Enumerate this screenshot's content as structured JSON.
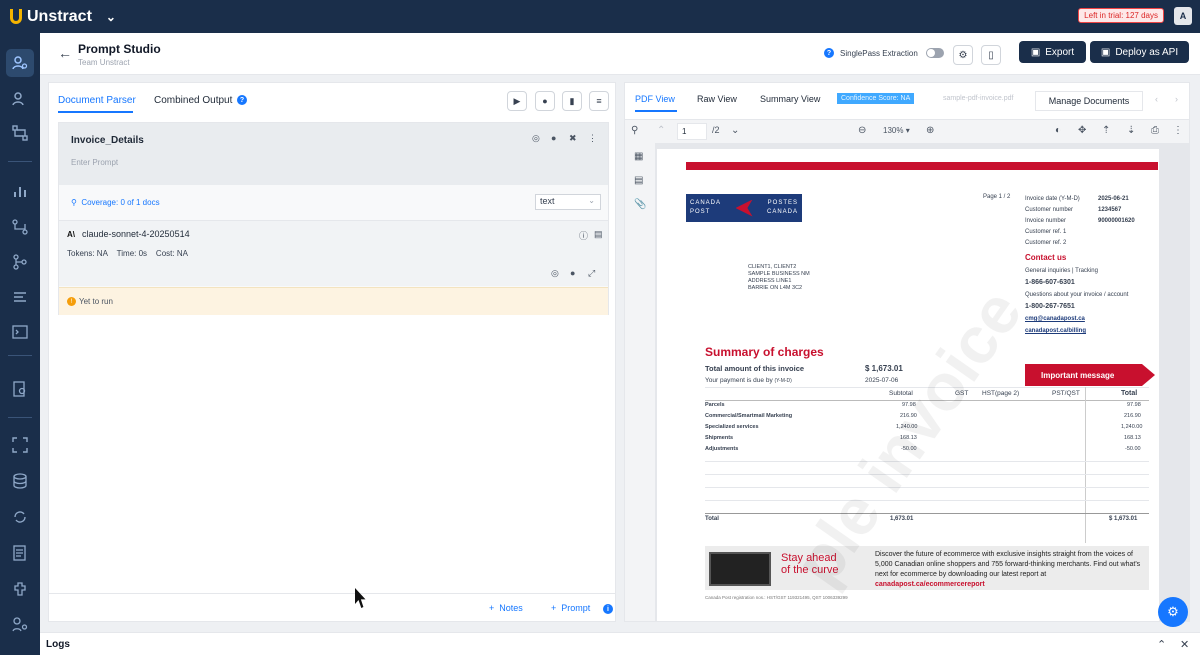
{
  "app": {
    "brand": "Unstract",
    "trial": "Left in trial: 127 days",
    "avatar": "A"
  },
  "header": {
    "title": "Prompt Studio",
    "subtitle": "Team Unstract",
    "singlepass_label": "SinglePass Extraction",
    "export_label": "Export",
    "deploy_label": "Deploy as API"
  },
  "left_panel": {
    "tabs": [
      "Document Parser",
      "Combined Output"
    ],
    "prompt_card": {
      "key": "Invoice_Details",
      "placeholder": "Enter Prompt",
      "coverage": "Coverage: 0 of 1 docs",
      "output_type": "text",
      "model": "claude-sonnet-4-20250514",
      "tokens": "Tokens: NA",
      "time": "Time: 0s",
      "cost": "Cost: NA",
      "status": "Yet to run"
    },
    "bottom": {
      "notes_label": "Notes",
      "prompt_label": "Prompt"
    }
  },
  "right_panel": {
    "tabs": [
      "PDF View",
      "Raw View",
      "Summary View"
    ],
    "confidence": "Confidence Score: NA",
    "filename": "sample-pdf-invoice.pdf",
    "manage_label": "Manage Documents",
    "pdf_toolbar": {
      "page": "1",
      "total": "/2",
      "zoom": "130%"
    }
  },
  "invoice": {
    "logo_lines": [
      "CANADA",
      "POSTES",
      "POST",
      "CANADA"
    ],
    "page": "Page 1 / 2",
    "meta_labels": [
      "Invoice date (Y-M-D)",
      "Customer number",
      "Invoice number",
      "Customer ref. 1",
      "Customer ref. 2"
    ],
    "meta_values": [
      "2025-06-21",
      "1234567",
      "90000001620",
      "",
      ""
    ],
    "contact_title": "Contact us",
    "contact_lines": [
      "General inquiries | Tracking",
      "1-866-607-6301",
      "Questions about your invoice / account",
      "1-800-267-7651",
      "cmg@canadapost.ca",
      "canadapost.ca/billing"
    ],
    "address": [
      "CLIENT1, CLIENT2",
      "SAMPLE BUSINESS NM",
      "ADDRESS LINE1",
      "BARRIE ON L4M 3C2"
    ],
    "summary_title": "Summary of charges",
    "total_label": "Total amount of this invoice",
    "total_value": "$ 1,673.01",
    "due_label": "Your payment is due by",
    "due_suffix": "(Y-M-D)",
    "due_value": "2025-07-06",
    "important": "Important message",
    "columns": [
      "Subtotal",
      "GST",
      "HST(page 2)",
      "PST/QST",
      "Total"
    ],
    "rows": [
      {
        "label": "Parcels",
        "subtotal": "97.98",
        "total": "97.98"
      },
      {
        "label": "Commercial/Smartmail Marketing",
        "subtotal": "216.90",
        "total": "216.90"
      },
      {
        "label": "Specialized services",
        "subtotal": "1,240.00",
        "total": "1,240.00"
      },
      {
        "label": "Shipments",
        "subtotal": "168.13",
        "total": "168.13"
      },
      {
        "label": "Adjustments",
        "subtotal": "-50.00",
        "total": "-50.00"
      }
    ],
    "total_row": {
      "label": "Total",
      "subtotal": "1,673.01",
      "total": "$ 1,673.01"
    },
    "ad_headline_1": "Stay ahead",
    "ad_headline_2": "of the curve",
    "ad_text": "Discover the future of ecommerce with exclusive insights straight from the voices of 5,000 Canadian online shoppers and 755 forward-thinking merchants. Find out what's next for ecommerce by downloading our latest report at",
    "ad_link": "canadapost.ca/ecommercereport",
    "footer": "Canada Post registration nos.: HST/GST 119321495, QST 1006339299",
    "watermark": "ple invoice"
  },
  "logs": {
    "label": "Logs"
  }
}
